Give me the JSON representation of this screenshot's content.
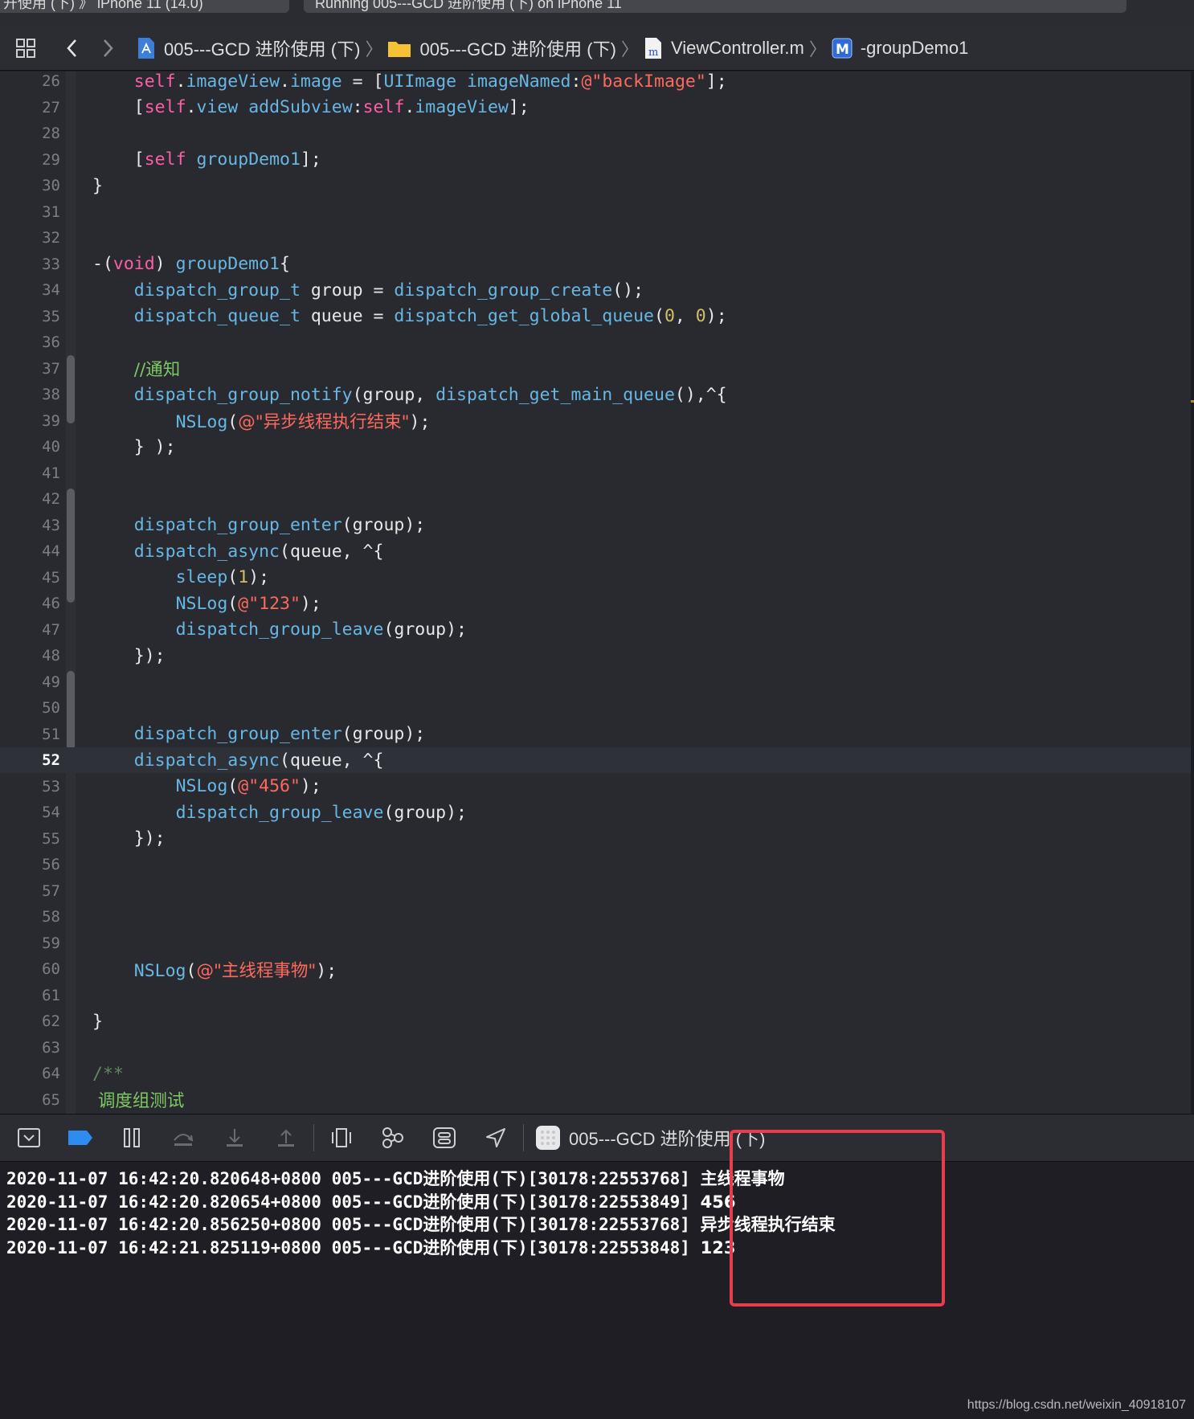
{
  "tabs": [
    {
      "label": "开使用 (下) 》 iPhone 11 (14.0)"
    },
    {
      "label": "Running 005---GCD 进阶使用 (下) on iPhone 11"
    }
  ],
  "jumpbar": {
    "crumbs": [
      {
        "label": "005---GCD 进阶使用 (下)",
        "icon": "project-icon"
      },
      {
        "label": "005---GCD 进阶使用 (下)",
        "icon": "folder-icon"
      },
      {
        "label": "ViewController.m",
        "icon": "objc-file-icon"
      },
      {
        "label": "-groupDemo1",
        "icon": "method-icon"
      }
    ]
  },
  "colors": {
    "keyword": "#fc5fa3",
    "function": "#67b7e4",
    "string": "#fc6a5d",
    "number": "#d0bf69",
    "comment": "#7dc962",
    "highlight": "#e83c4f"
  },
  "editor": {
    "current_line": "52",
    "lines": [
      {
        "n": "26",
        "t": [
          [
            "",
            "    "
          ],
          [
            "kw",
            "self"
          ],
          [
            "",
            "."
          ],
          [
            "fn",
            "imageView"
          ],
          [
            "",
            "."
          ],
          [
            "fn",
            "image"
          ],
          [
            "",
            " = ["
          ],
          [
            "fn",
            "UIImage"
          ],
          [
            "",
            " "
          ],
          [
            "fn",
            "imageNamed"
          ],
          [
            "",
            ":"
          ],
          [
            "str",
            "@\"backImage\""
          ],
          [
            "",
            "];"
          ]
        ]
      },
      {
        "n": "27",
        "t": [
          [
            "",
            "    ["
          ],
          [
            "kw",
            "self"
          ],
          [
            "",
            "."
          ],
          [
            "fn",
            "view"
          ],
          [
            "",
            " "
          ],
          [
            "fn",
            "addSubview"
          ],
          [
            "",
            ":"
          ],
          [
            "kw",
            "self"
          ],
          [
            "",
            "."
          ],
          [
            "fn",
            "imageView"
          ],
          [
            "",
            "];"
          ]
        ]
      },
      {
        "n": "28",
        "t": []
      },
      {
        "n": "29",
        "t": [
          [
            "",
            "    ["
          ],
          [
            "kw",
            "self"
          ],
          [
            "",
            " "
          ],
          [
            "fn",
            "groupDemo1"
          ],
          [
            "",
            "];"
          ]
        ]
      },
      {
        "n": "30",
        "t": [
          [
            "",
            "}"
          ]
        ]
      },
      {
        "n": "31",
        "t": []
      },
      {
        "n": "32",
        "t": []
      },
      {
        "n": "33",
        "t": [
          [
            "",
            "-("
          ],
          [
            "kw",
            "void"
          ],
          [
            "",
            ") "
          ],
          [
            "fn",
            "groupDemo1"
          ],
          [
            "",
            "{"
          ]
        ]
      },
      {
        "n": "34",
        "t": [
          [
            "",
            "    "
          ],
          [
            "fn",
            "dispatch_group_t"
          ],
          [
            "",
            " group = "
          ],
          [
            "fn",
            "dispatch_group_create"
          ],
          [
            "",
            "();"
          ]
        ]
      },
      {
        "n": "35",
        "t": [
          [
            "",
            "    "
          ],
          [
            "fn",
            "dispatch_queue_t"
          ],
          [
            "",
            " queue = "
          ],
          [
            "fn",
            "dispatch_get_global_queue"
          ],
          [
            "",
            "("
          ],
          [
            "num",
            "0"
          ],
          [
            "",
            ", "
          ],
          [
            "num",
            "0"
          ],
          [
            "",
            ");"
          ]
        ]
      },
      {
        "n": "36",
        "t": []
      },
      {
        "n": "37",
        "t": [
          [
            "",
            "    "
          ],
          [
            "cm",
            "//通知"
          ]
        ]
      },
      {
        "n": "38",
        "t": [
          [
            "",
            "    "
          ],
          [
            "fn",
            "dispatch_group_notify"
          ],
          [
            "",
            "(group, "
          ],
          [
            "fn",
            "dispatch_get_main_queue"
          ],
          [
            "",
            "(),^{"
          ]
        ]
      },
      {
        "n": "39",
        "t": [
          [
            "",
            "        "
          ],
          [
            "fn",
            "NSLog"
          ],
          [
            "",
            "("
          ],
          [
            "str",
            "@\"异步线程执行结束\""
          ],
          [
            "",
            ");"
          ]
        ]
      },
      {
        "n": "40",
        "t": [
          [
            "",
            "    } );"
          ]
        ]
      },
      {
        "n": "41",
        "t": []
      },
      {
        "n": "42",
        "t": []
      },
      {
        "n": "43",
        "t": [
          [
            "",
            "    "
          ],
          [
            "fn",
            "dispatch_group_enter"
          ],
          [
            "",
            "(group);"
          ]
        ]
      },
      {
        "n": "44",
        "t": [
          [
            "",
            "    "
          ],
          [
            "fn",
            "dispatch_async"
          ],
          [
            "",
            "(queue, ^{"
          ]
        ]
      },
      {
        "n": "45",
        "t": [
          [
            "",
            "        "
          ],
          [
            "fn",
            "sleep"
          ],
          [
            "",
            "("
          ],
          [
            "num",
            "1"
          ],
          [
            "",
            ");"
          ]
        ]
      },
      {
        "n": "46",
        "t": [
          [
            "",
            "        "
          ],
          [
            "fn",
            "NSLog"
          ],
          [
            "",
            "("
          ],
          [
            "str",
            "@\"123\""
          ],
          [
            "",
            ");"
          ]
        ]
      },
      {
        "n": "47",
        "t": [
          [
            "",
            "        "
          ],
          [
            "fn",
            "dispatch_group_leave"
          ],
          [
            "",
            "(group);"
          ]
        ]
      },
      {
        "n": "48",
        "t": [
          [
            "",
            "    });"
          ]
        ]
      },
      {
        "n": "49",
        "t": []
      },
      {
        "n": "50",
        "t": []
      },
      {
        "n": "51",
        "t": [
          [
            "",
            "    "
          ],
          [
            "fn",
            "dispatch_group_enter"
          ],
          [
            "",
            "(group);"
          ]
        ]
      },
      {
        "n": "52",
        "t": [
          [
            "",
            "    "
          ],
          [
            "fn",
            "dispatch_async"
          ],
          [
            "",
            "(queue, ^{"
          ]
        ]
      },
      {
        "n": "53",
        "t": [
          [
            "",
            "        "
          ],
          [
            "fn",
            "NSLog"
          ],
          [
            "",
            "("
          ],
          [
            "str",
            "@\"456\""
          ],
          [
            "",
            ");"
          ]
        ]
      },
      {
        "n": "54",
        "t": [
          [
            "",
            "        "
          ],
          [
            "fn",
            "dispatch_group_leave"
          ],
          [
            "",
            "(group);"
          ]
        ]
      },
      {
        "n": "55",
        "t": [
          [
            "",
            "    });"
          ]
        ]
      },
      {
        "n": "56",
        "t": []
      },
      {
        "n": "57",
        "t": []
      },
      {
        "n": "58",
        "t": []
      },
      {
        "n": "59",
        "t": []
      },
      {
        "n": "60",
        "t": [
          [
            "",
            "    "
          ],
          [
            "fn",
            "NSLog"
          ],
          [
            "",
            "("
          ],
          [
            "str",
            "@\"主线程事物\""
          ],
          [
            "",
            ");"
          ]
        ]
      },
      {
        "n": "61",
        "t": []
      },
      {
        "n": "62",
        "t": [
          [
            "",
            "}"
          ]
        ]
      },
      {
        "n": "63",
        "t": []
      },
      {
        "n": "64",
        "t": [
          [
            "doc",
            "/**"
          ]
        ]
      },
      {
        "n": "65",
        "t": [
          [
            "cm",
            " 调度组测试"
          ]
        ]
      }
    ]
  },
  "debugbar": {
    "target_label": "005---GCD 进阶使用 (下)"
  },
  "console": {
    "lines": [
      {
        "prefix": "2020-11-07 16:42:20.820648+0800 005---GCD进阶使用(下)[30178:22553768] ",
        "message": "主线程事物"
      },
      {
        "prefix": "2020-11-07 16:42:20.820654+0800 005---GCD进阶使用(下)[30178:22553849] ",
        "message": "456"
      },
      {
        "prefix": "2020-11-07 16:42:20.856250+0800 005---GCD进阶使用(下)[30178:22553768] ",
        "message": "异步线程执行结束"
      },
      {
        "prefix": "2020-11-07 16:42:21.825119+0800 005---GCD进阶使用(下)[30178:22553848] ",
        "message": "123"
      }
    ]
  },
  "watermark": "https://blog.csdn.net/weixin_40918107"
}
